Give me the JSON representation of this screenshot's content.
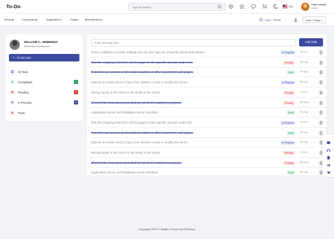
{
  "header": {
    "title": "To-Do",
    "search_placeholder": "Type to Search...",
    "language": "EN",
    "user_name": "Fatim Mahat",
    "user_role": "Admin"
  },
  "nav": {
    "items": [
      "General",
      "Components",
      "Applications",
      "Pages",
      "Miscellaneous"
    ],
    "breadcrumb": [
      "Apps",
      "/",
      "To-Do"
    ],
    "period": "Last 7 Days"
  },
  "profile": {
    "name": "WILLIAM C. JENNINGS",
    "email": "william@pixelplanp.com"
  },
  "sidebar": {
    "button": "To Do List",
    "items": [
      {
        "label": "All Task",
        "count": "",
        "icon": "file-icon",
        "color": "#3d4aa0"
      },
      {
        "label": "Completed",
        "count": "3",
        "icon": "check-circle-icon",
        "color": "#219653"
      },
      {
        "label": "Pending",
        "count": "2",
        "icon": "clock-icon",
        "color": "#d23a3a"
      },
      {
        "label": "In Process",
        "count": "2",
        "icon": "activity-icon",
        "color": "#3d4aa0"
      },
      {
        "label": "Trash",
        "count": "",
        "icon": "trash-icon",
        "color": "#d23a3a"
      }
    ]
  },
  "main": {
    "new_task_placeholder": "Enter new task item...",
    "add_button": "Add Task",
    "tasks": [
      {
        "text": "Check validation involves making sure all your tags are properly closed and nested.",
        "status": "In Progress",
        "date": "10 Nov",
        "done": false
      },
      {
        "text": "Test the outgoing links from all the pages to the specific domain under test.",
        "status": "Pending",
        "date": "06 Aug",
        "done": true
      },
      {
        "text": "Test links are used to send emails to admin or other users from web pages.",
        "status": "Done",
        "date": "29 Aug",
        "done": true
      },
      {
        "text": "Options to create forms, if any, form deletes a view or modify the forms.",
        "status": "In Progress",
        "date": "06 Aug",
        "done": false
      },
      {
        "text": "Wrong inputs in the forms to the fields in the forms.",
        "status": "Pending",
        "date": "11 Nov",
        "done": false
      },
      {
        "text": "Check if the instructions provided are perfect to satisfy its purpose.",
        "status": "Pending",
        "date": "08 Sept",
        "done": true
      },
      {
        "text": "Application server and Database server interface.",
        "status": "Done",
        "date": "05 Aug",
        "done": false
      },
      {
        "text": "Test the outgoing links from all the pages to the specific domain under test.",
        "status": "In Progress",
        "date": "10 Nov",
        "done": false
      },
      {
        "text": "Test links are used to send emails to admin or other users from web pages.",
        "status": "Done",
        "date": "29 Aug",
        "done": true
      },
      {
        "text": "Options to create forms, if any, form deletes a view or modify the forms.",
        "status": "In Progress",
        "date": "06 Aug",
        "done": false
      },
      {
        "text": "Wrong inputs in the forms to the fields in the forms.",
        "status": "Pending",
        "date": "11 Nov",
        "done": false
      },
      {
        "text": "Check if the instructions provided are perfect to satisfy its purpose.",
        "status": "Pending",
        "date": "08 Sept",
        "done": true
      },
      {
        "text": "Application server and Database server interface.",
        "status": "Done",
        "date": "05 Aug",
        "done": false
      }
    ]
  },
  "footer": {
    "text": "Copyright 2023 © Malako Theme By Pixelstrap"
  },
  "colors": {
    "primary": "#3d4aa0",
    "pending": "#d23a3a",
    "done": "#219653"
  }
}
